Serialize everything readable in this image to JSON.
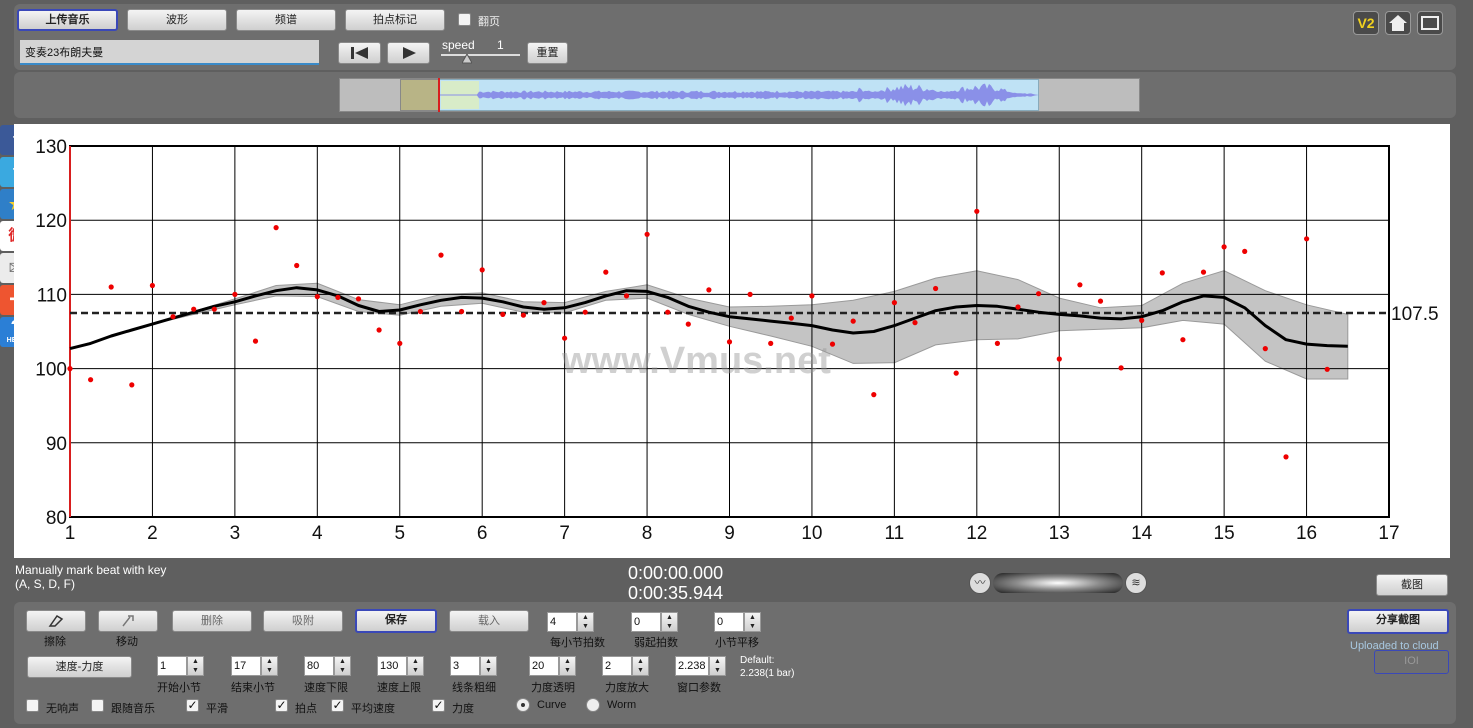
{
  "toolbar": {
    "upload_label": "上传音乐",
    "waveform_label": "波形",
    "spectrum_label": "频谱",
    "beat_mark_label": "拍点标记",
    "page_turn_label": "翻页",
    "track_name": "变奏23布朗夫曼",
    "speed_label": "speed",
    "speed_value": "1",
    "reset_label": "重置",
    "v2_label": "V2",
    "icons": [
      "v2-icon",
      "home-icon",
      "fullscreen-icon"
    ]
  },
  "social": [
    "facebook-icon",
    "twitter-icon",
    "favorite-icon",
    "weibo-icon",
    "mail-icon",
    "share-plus-icon",
    "help-icon"
  ],
  "social_glyphs": {
    "facebook": "f",
    "twitter": "t",
    "favorite": "★",
    "weibo": "微",
    "mail": "✉",
    "plus": "+",
    "help": "?",
    "help_text": "HELP"
  },
  "watermark": "www.Vmus.net",
  "status": {
    "hint_line1": "Manually mark beat with key",
    "hint_line2": "(A, S, D, F)",
    "time_current": "0:00:00.000",
    "time_total": "0:00:35.944",
    "screenshot_label": "截图"
  },
  "controls": {
    "erase_label": "擦除",
    "move_label": "移动",
    "delete_label": "删除",
    "snap_label": "吸附",
    "save_label": "保存",
    "load_label": "载入",
    "share_label": "分享截图",
    "uploaded_label": "Uploaded to cloud",
    "ioi_label": "IOI",
    "tempo_dynamics_label": "速度-力度",
    "default_line1": "Default:",
    "default_line2": "2.238(1 bar)",
    "spinners": [
      {
        "label": "每小节拍数",
        "value": "4"
      },
      {
        "label": "弱起拍数",
        "value": "0"
      },
      {
        "label": "小节平移",
        "value": "0"
      },
      {
        "label": "开始小节",
        "value": "1"
      },
      {
        "label": "结束小节",
        "value": "17"
      },
      {
        "label": "速度下限",
        "value": "80"
      },
      {
        "label": "速度上限",
        "value": "130"
      },
      {
        "label": "线条粗细",
        "value": "3"
      },
      {
        "label": "力度透明",
        "value": "20"
      },
      {
        "label": "力度放大",
        "value": "2"
      },
      {
        "label": "窗口参数",
        "value": "2.238"
      }
    ],
    "checks": [
      {
        "label": "无响声",
        "checked": false
      },
      {
        "label": "跟随音乐",
        "checked": false
      },
      {
        "label": "平滑",
        "checked": true
      },
      {
        "label": "拍点",
        "checked": true
      },
      {
        "label": "平均速度",
        "checked": true
      },
      {
        "label": "力度",
        "checked": true
      }
    ],
    "radios": [
      {
        "label": "Curve",
        "selected": true
      },
      {
        "label": "Worm",
        "selected": false
      }
    ]
  },
  "chart_data": {
    "type": "scatter",
    "xlim": [
      1,
      17
    ],
    "ylim": [
      80,
      130
    ],
    "x_ticks": [
      "1",
      "2",
      "3",
      "4",
      "5",
      "6",
      "7",
      "8",
      "9",
      "10",
      "11",
      "12",
      "13",
      "14",
      "15",
      "16",
      "17"
    ],
    "y_ticks": [
      "80",
      "90",
      "100",
      "110",
      "120",
      "130"
    ],
    "mean_tempo": 107.5,
    "mean_label": "107.5",
    "points": [
      [
        1.0,
        100.0
      ],
      [
        1.25,
        98.5
      ],
      [
        1.5,
        111.0
      ],
      [
        1.75,
        97.8
      ],
      [
        2.0,
        111.2
      ],
      [
        2.25,
        107.0
      ],
      [
        2.5,
        108.0
      ],
      [
        2.75,
        108.0
      ],
      [
        3.0,
        110.0
      ],
      [
        3.25,
        103.7
      ],
      [
        3.5,
        119.0
      ],
      [
        3.75,
        113.9
      ],
      [
        4.0,
        109.7
      ],
      [
        4.25,
        109.6
      ],
      [
        4.5,
        109.4
      ],
      [
        4.75,
        105.2
      ],
      [
        5.0,
        103.4
      ],
      [
        5.25,
        107.7
      ],
      [
        5.5,
        115.3
      ],
      [
        5.75,
        107.7
      ],
      [
        6.0,
        113.3
      ],
      [
        6.25,
        107.3
      ],
      [
        6.5,
        107.2
      ],
      [
        6.75,
        108.9
      ],
      [
        7.0,
        104.1
      ],
      [
        7.25,
        107.6
      ],
      [
        7.5,
        113.0
      ],
      [
        7.75,
        109.8
      ],
      [
        8.0,
        118.1
      ],
      [
        8.25,
        107.6
      ],
      [
        8.5,
        106.0
      ],
      [
        8.75,
        110.6
      ],
      [
        9.0,
        103.6
      ],
      [
        9.25,
        110.0
      ],
      [
        9.5,
        103.4
      ],
      [
        9.75,
        106.8
      ],
      [
        10.0,
        109.8
      ],
      [
        10.25,
        103.3
      ],
      [
        10.5,
        106.4
      ],
      [
        10.75,
        96.5
      ],
      [
        11.0,
        108.9
      ],
      [
        11.25,
        106.2
      ],
      [
        11.5,
        110.8
      ],
      [
        11.75,
        99.4
      ],
      [
        12.0,
        121.2
      ],
      [
        12.25,
        103.4
      ],
      [
        12.5,
        108.3
      ],
      [
        12.75,
        110.1
      ],
      [
        13.0,
        101.3
      ],
      [
        13.25,
        111.3
      ],
      [
        13.5,
        109.1
      ],
      [
        13.75,
        100.1
      ],
      [
        14.0,
        106.5
      ],
      [
        14.25,
        112.9
      ],
      [
        14.5,
        103.9
      ],
      [
        14.75,
        113.0
      ],
      [
        15.0,
        116.4
      ],
      [
        15.25,
        115.8
      ],
      [
        15.5,
        102.7
      ],
      [
        15.75,
        88.1
      ],
      [
        16.0,
        117.5
      ],
      [
        16.25,
        99.9
      ]
    ],
    "curve": [
      [
        1.0,
        102.7
      ],
      [
        1.25,
        103.4
      ],
      [
        1.5,
        104.4
      ],
      [
        1.75,
        105.2
      ],
      [
        2.0,
        106.0
      ],
      [
        2.25,
        106.8
      ],
      [
        2.5,
        107.6
      ],
      [
        2.75,
        108.4
      ],
      [
        3.0,
        109.0
      ],
      [
        3.25,
        109.8
      ],
      [
        3.5,
        110.5
      ],
      [
        3.75,
        110.9
      ],
      [
        4.0,
        110.6
      ],
      [
        4.25,
        109.8
      ],
      [
        4.5,
        108.5
      ],
      [
        4.75,
        107.7
      ],
      [
        5.0,
        107.9
      ],
      [
        5.25,
        108.6
      ],
      [
        5.5,
        109.2
      ],
      [
        5.75,
        109.6
      ],
      [
        6.0,
        109.5
      ],
      [
        6.25,
        109.0
      ],
      [
        6.5,
        108.3
      ],
      [
        6.75,
        108.0
      ],
      [
        7.0,
        108.2
      ],
      [
        7.25,
        108.9
      ],
      [
        7.5,
        109.8
      ],
      [
        7.75,
        110.5
      ],
      [
        8.0,
        110.4
      ],
      [
        8.25,
        109.6
      ],
      [
        8.5,
        108.4
      ],
      [
        8.75,
        107.6
      ],
      [
        9.0,
        107.0
      ],
      [
        9.25,
        106.7
      ],
      [
        9.5,
        106.4
      ],
      [
        9.75,
        106.1
      ],
      [
        10.0,
        105.8
      ],
      [
        10.25,
        105.2
      ],
      [
        10.5,
        104.8
      ],
      [
        10.75,
        105.0
      ],
      [
        11.0,
        105.8
      ],
      [
        11.25,
        106.8
      ],
      [
        11.5,
        107.8
      ],
      [
        11.75,
        108.3
      ],
      [
        12.0,
        108.5
      ],
      [
        12.25,
        108.4
      ],
      [
        12.5,
        108.0
      ],
      [
        12.75,
        107.6
      ],
      [
        13.0,
        107.3
      ],
      [
        13.25,
        107.1
      ],
      [
        13.5,
        106.8
      ],
      [
        13.75,
        106.7
      ],
      [
        14.0,
        107.0
      ],
      [
        14.25,
        107.8
      ],
      [
        14.5,
        109.0
      ],
      [
        14.75,
        109.8
      ],
      [
        15.0,
        109.6
      ],
      [
        15.25,
        108.2
      ],
      [
        15.5,
        105.8
      ],
      [
        15.75,
        103.9
      ],
      [
        16.0,
        103.3
      ],
      [
        16.25,
        103.1
      ],
      [
        16.5,
        103.0
      ]
    ],
    "band_upper": [
      [
        1.0,
        102.7
      ],
      [
        2.0,
        106.0
      ],
      [
        3.0,
        109.4
      ],
      [
        3.5,
        111.2
      ],
      [
        4.0,
        111.5
      ],
      [
        4.5,
        109.3
      ],
      [
        5.0,
        108.6
      ],
      [
        5.5,
        110.0
      ],
      [
        6.0,
        110.2
      ],
      [
        6.5,
        109.0
      ],
      [
        7.0,
        108.9
      ],
      [
        7.5,
        110.4
      ],
      [
        8.0,
        111.3
      ],
      [
        8.5,
        109.5
      ],
      [
        9.0,
        108.3
      ],
      [
        9.5,
        108.4
      ],
      [
        10.0,
        108.6
      ],
      [
        10.5,
        109.2
      ],
      [
        11.0,
        110.4
      ],
      [
        11.5,
        112.2
      ],
      [
        12.0,
        113.2
      ],
      [
        12.5,
        112.0
      ],
      [
        13.0,
        109.5
      ],
      [
        13.5,
        108.2
      ],
      [
        14.0,
        108.5
      ],
      [
        14.5,
        111.5
      ],
      [
        15.0,
        113.2
      ],
      [
        15.5,
        110.5
      ],
      [
        16.0,
        108.6
      ],
      [
        16.5,
        107.3
      ]
    ],
    "band_lower": [
      [
        1.0,
        102.7
      ],
      [
        2.0,
        106.0
      ],
      [
        3.0,
        108.6
      ],
      [
        3.5,
        109.8
      ],
      [
        4.0,
        109.7
      ],
      [
        4.5,
        107.7
      ],
      [
        5.0,
        107.2
      ],
      [
        5.5,
        108.4
      ],
      [
        6.0,
        108.8
      ],
      [
        6.5,
        107.6
      ],
      [
        7.0,
        107.5
      ],
      [
        7.5,
        109.2
      ],
      [
        8.0,
        109.5
      ],
      [
        8.5,
        107.3
      ],
      [
        9.0,
        105.7
      ],
      [
        9.5,
        104.4
      ],
      [
        10.0,
        103.0
      ],
      [
        10.5,
        100.7
      ],
      [
        11.0,
        100.8
      ],
      [
        11.5,
        103.2
      ],
      [
        12.0,
        103.9
      ],
      [
        12.5,
        104.0
      ],
      [
        13.0,
        105.1
      ],
      [
        13.5,
        105.3
      ],
      [
        14.0,
        105.5
      ],
      [
        14.5,
        106.5
      ],
      [
        15.0,
        106.0
      ],
      [
        15.5,
        101.0
      ],
      [
        16.0,
        98.6
      ],
      [
        16.5,
        98.6
      ]
    ]
  },
  "colors": {
    "accent": "#3a48b8",
    "point": "#ee0000",
    "curve": "#000000",
    "band": "#c4c4c4",
    "waveform": "#8a90e8",
    "selection": "#bfe2f5",
    "red_cursor": "#d81e1e"
  }
}
